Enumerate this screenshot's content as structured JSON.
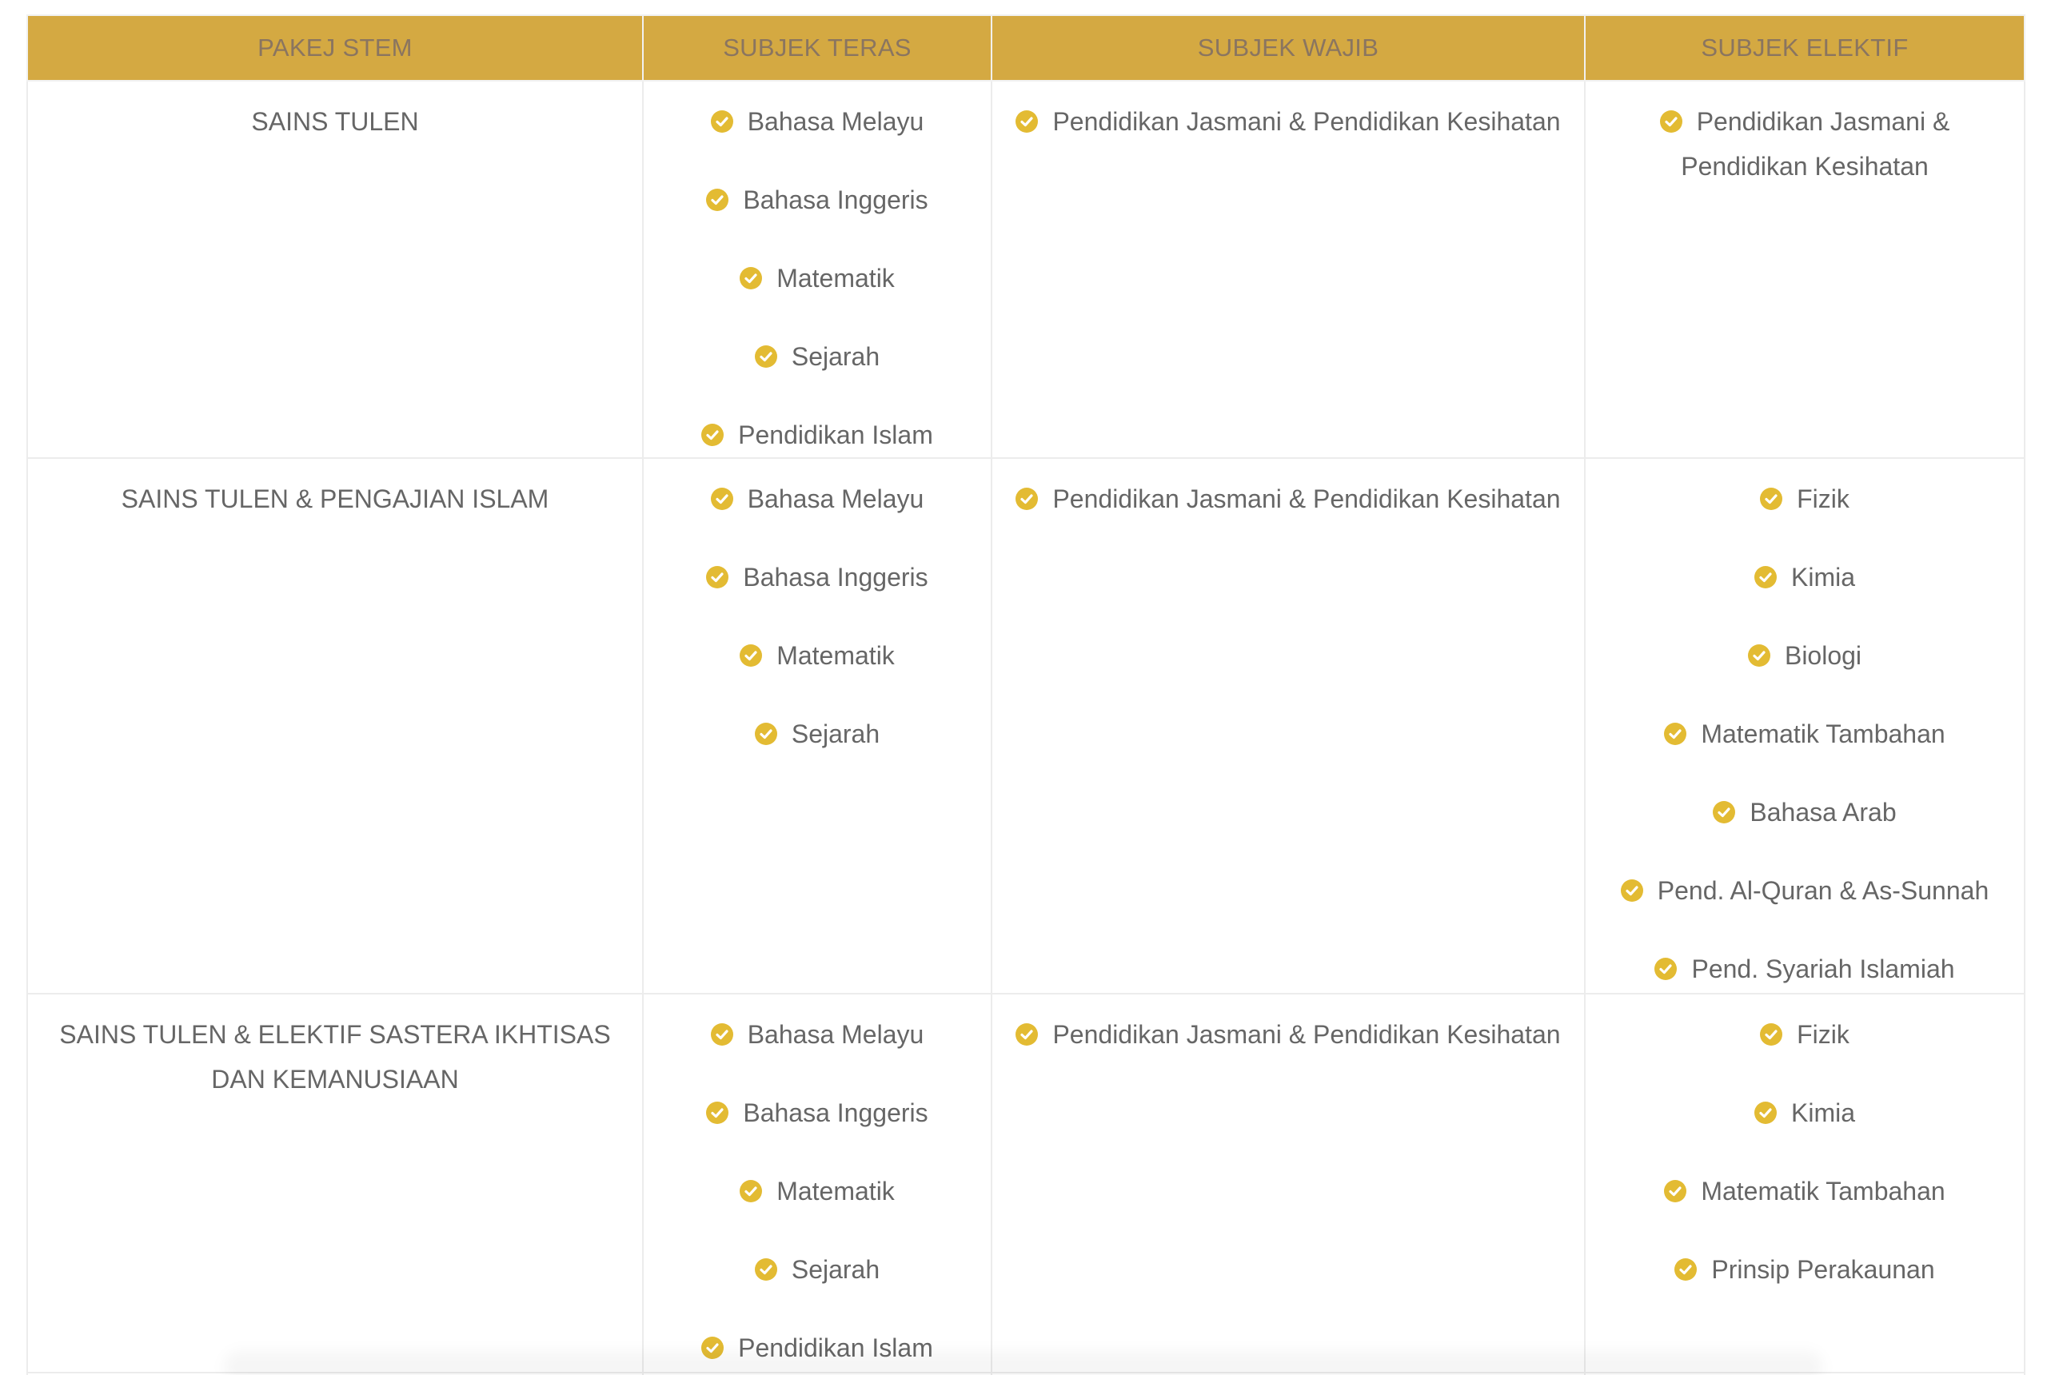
{
  "headers": [
    "PAKEJ STEM",
    "SUBJEK TERAS",
    "SUBJEK WAJIB",
    "SUBJEK ELEKTIF"
  ],
  "accent_color": "#d4a942",
  "check_color": "#e3bb33",
  "icon": "check-circle-icon",
  "rows": [
    {
      "package": "SAINS TULEN",
      "teras": [
        "Bahasa Melayu",
        "Bahasa Inggeris",
        "Matematik",
        "Sejarah",
        "Pendidikan Islam"
      ],
      "wajib": [
        "Pendidikan Jasmani & Pendidikan Kesihatan"
      ],
      "elektif": [
        "Pendidikan Jasmani & Pendidikan Kesihatan"
      ]
    },
    {
      "package": "SAINS TULEN & PENGAJIAN ISLAM",
      "teras": [
        "Bahasa Melayu",
        "Bahasa Inggeris",
        "Matematik",
        "Sejarah"
      ],
      "wajib": [
        "Pendidikan Jasmani & Pendidikan Kesihatan"
      ],
      "elektif": [
        "Fizik",
        "Kimia",
        "Biologi",
        "Matematik Tambahan",
        "Bahasa Arab",
        "Pend. Al-Quran & As-Sunnah",
        "Pend. Syariah Islamiah"
      ]
    },
    {
      "package": "SAINS TULEN & ELEKTIF SASTERA IKHTISAS DAN KEMANUSIAAN",
      "teras": [
        "Bahasa Melayu",
        "Bahasa Inggeris",
        "Matematik",
        "Sejarah",
        "Pendidikan Islam"
      ],
      "wajib": [
        "Pendidikan Jasmani & Pendidikan Kesihatan"
      ],
      "elektif": [
        "Fizik",
        "Kimia",
        "Matematik Tambahan",
        "Prinsip Perakaunan"
      ]
    }
  ]
}
